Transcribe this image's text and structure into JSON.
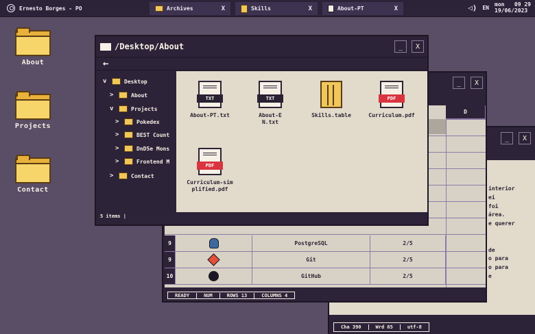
{
  "taskbar": {
    "user": "Ernesto Borges - PO",
    "tabs": [
      {
        "label": "Archives",
        "icon": "folder-icon",
        "close": "X"
      },
      {
        "label": "Skills",
        "icon": "table-icon",
        "close": "X"
      },
      {
        "label": "About-PT",
        "icon": "document-icon",
        "close": "X"
      }
    ],
    "language": "EN",
    "day": "mon",
    "time": "09 29",
    "date": "19/06/2023"
  },
  "desktop": {
    "icons": [
      {
        "label": "About"
      },
      {
        "label": "Projects"
      },
      {
        "label": "Contact"
      }
    ]
  },
  "explorer": {
    "title": "/Desktop/About",
    "minimize": "_",
    "close": "X",
    "back": "←",
    "tree": [
      {
        "label": "Desktop",
        "chevron": "v"
      },
      {
        "label": "About",
        "chevron": ">"
      },
      {
        "label": "Projects",
        "chevron": "v"
      },
      {
        "label": "Pokedex",
        "chevron": ">"
      },
      {
        "label": "BEST Count",
        "chevron": ">"
      },
      {
        "label": "DnD5e Mons",
        "chevron": ">"
      },
      {
        "label": "Frontend M",
        "chevron": ">"
      },
      {
        "label": "Contact",
        "chevron": ">"
      }
    ],
    "files": [
      {
        "name": "About-PT.txt",
        "badge": "TXT"
      },
      {
        "name": "About-EN.txt",
        "badge": "TXT"
      },
      {
        "name": "Skills.table",
        "badge": ""
      },
      {
        "name": "Curriculum.pdf",
        "badge": "PDF"
      },
      {
        "name": "Curriculum-simplified.pdf",
        "badge": "PDF"
      }
    ],
    "status": "5 items |"
  },
  "skills": {
    "minimize": "_",
    "close": "X",
    "col_d": "D",
    "rows": [
      {
        "num": "9",
        "name": "PostgreSQL",
        "level": "2/5"
      },
      {
        "num": "9",
        "name": "Git",
        "level": "2/5"
      },
      {
        "num": "10",
        "name": "GitHub",
        "level": "2/5"
      }
    ],
    "status": [
      "READY",
      "NUM",
      "ROWS 13",
      "COLUMNS 4"
    ]
  },
  "text_window": {
    "minimize": "_",
    "close": "X",
    "lines": [
      "interior",
      "ei",
      "foi",
      "área.",
      "e querer",
      "",
      "",
      "de",
      "o para",
      "o para",
      "e"
    ],
    "status": [
      "Cha 390",
      "Wrd 65",
      "utf-8"
    ]
  },
  "colors": {
    "desktop": "#5a4d66",
    "window_dark": "#2c2338",
    "paper": "#e2dacb",
    "folder": "#e8b13a",
    "pdf_red": "#d9343f"
  }
}
